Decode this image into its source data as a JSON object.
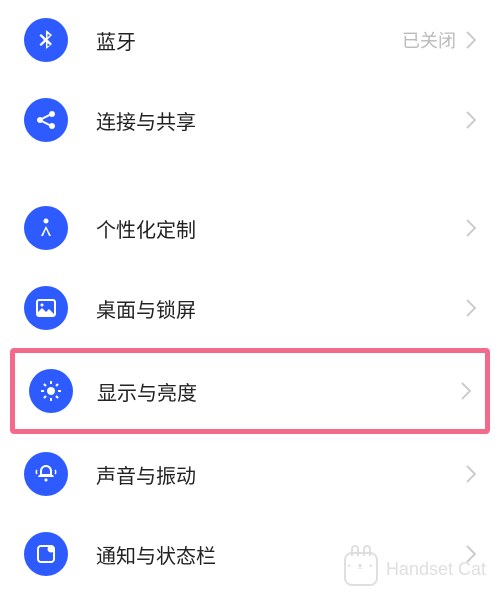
{
  "colors": {
    "icon_bg": "#2e5bff",
    "highlight_border": "#f46a8b"
  },
  "groups": [
    {
      "items": [
        {
          "id": "bluetooth",
          "icon": "bluetooth-icon",
          "label": "蓝牙",
          "status": "已关闭"
        },
        {
          "id": "connect-share",
          "icon": "share-icon",
          "label": "连接与共享"
        }
      ]
    },
    {
      "items": [
        {
          "id": "personalization",
          "icon": "compass-icon",
          "label": "个性化定制"
        },
        {
          "id": "desktop-lockscreen",
          "icon": "image-icon",
          "label": "桌面与锁屏"
        },
        {
          "id": "display-brightness",
          "icon": "brightness-icon",
          "label": "显示与亮度",
          "highlighted": true
        },
        {
          "id": "sound-vibration",
          "icon": "sound-icon",
          "label": "声音与振动"
        },
        {
          "id": "notifications-statusbar",
          "icon": "notification-icon",
          "label": "通知与状态栏"
        }
      ]
    }
  ],
  "watermark": "Handset Cat"
}
